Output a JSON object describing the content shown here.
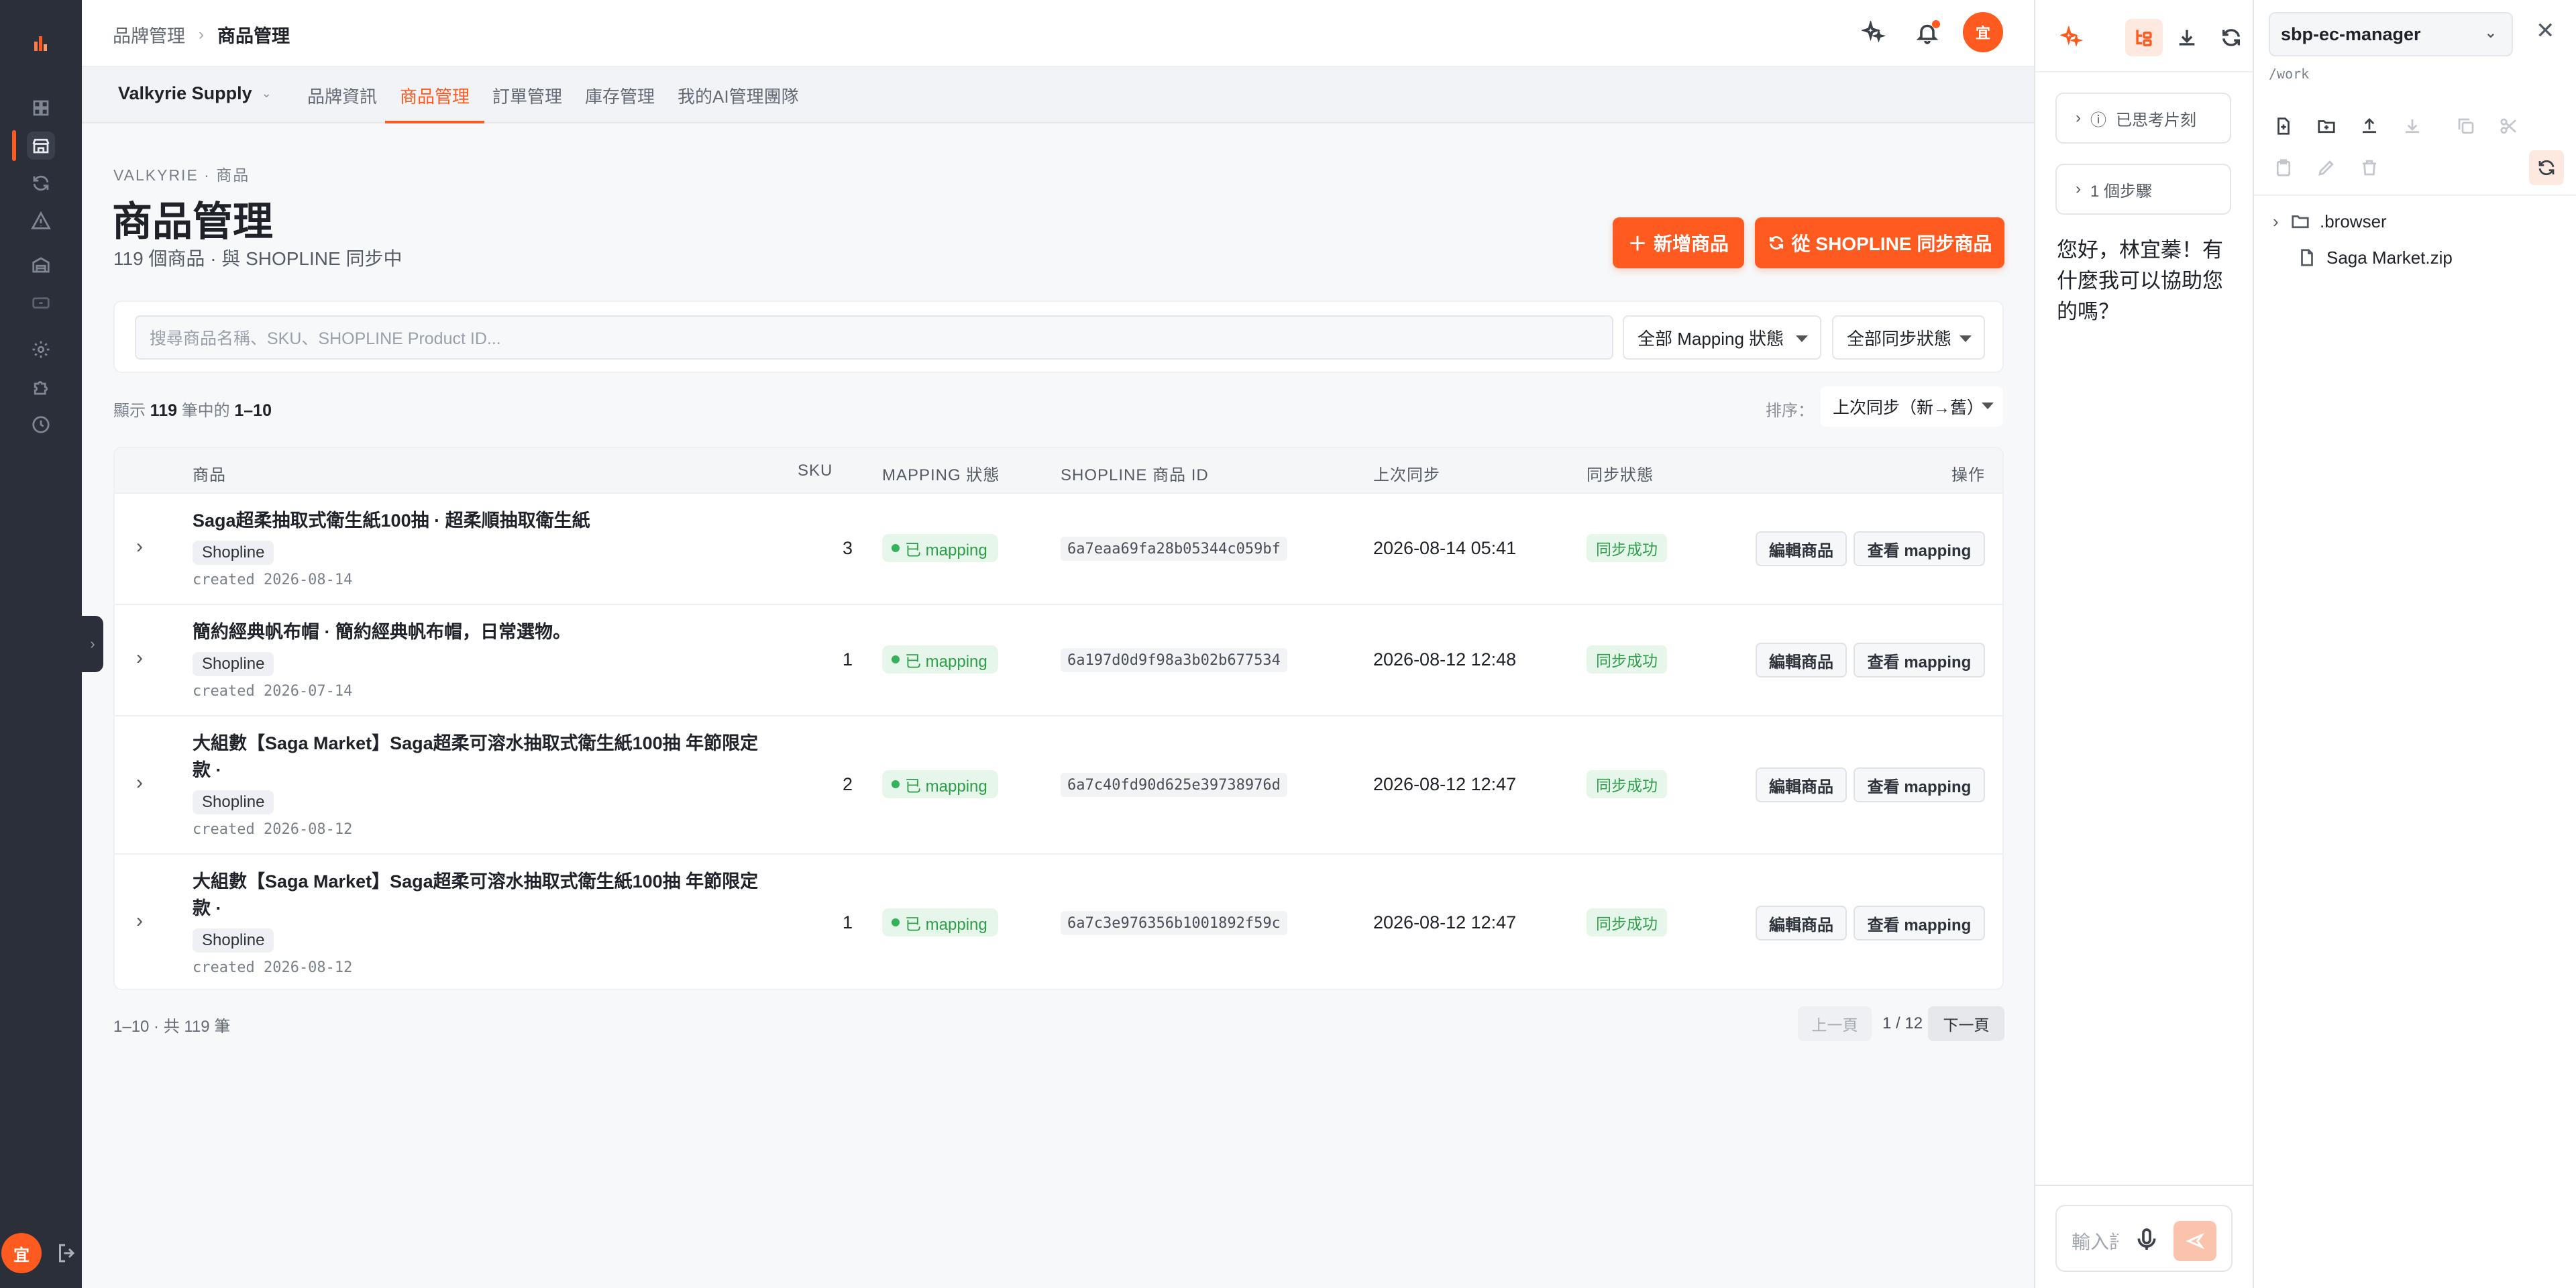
{
  "sidebar": {
    "items": [
      {
        "icon": "dashboard-icon"
      },
      {
        "icon": "store-icon",
        "active": true
      },
      {
        "icon": "sync-icon"
      },
      {
        "icon": "alert-icon"
      },
      {
        "icon": "warehouse-icon"
      },
      {
        "icon": "card-icon"
      },
      {
        "icon": "settings-icon"
      },
      {
        "icon": "puzzle-icon"
      },
      {
        "icon": "history-icon"
      }
    ],
    "avatar_text": "宜",
    "collapse_icon": "›"
  },
  "header": {
    "breadcrumb_parent": "品牌管理",
    "breadcrumb_sep": "›",
    "breadcrumb_current": "商品管理",
    "avatar_text": "宜"
  },
  "subnav": {
    "brand": "Valkyrie Supply",
    "tabs": [
      {
        "label": "品牌資訊"
      },
      {
        "label": "商品管理",
        "active": true
      },
      {
        "label": "訂單管理"
      },
      {
        "label": "庫存管理"
      },
      {
        "label": "我的AI管理團隊"
      }
    ]
  },
  "page": {
    "eyebrow": "VALKYRIE · 商品",
    "title": "商品管理",
    "subtitle": "119 個商品 · 與 SHOPLINE 同步中",
    "btn_add": "新增商品",
    "btn_sync": "從 SHOPLINE 同步商品"
  },
  "filters": {
    "search_placeholder": "搜尋商品名稱、SKU、SHOPLINE Product ID...",
    "mapping_status": "全部 Mapping 狀態",
    "sync_status": "全部同步狀態"
  },
  "results": {
    "prefix": "顯示",
    "total": "119",
    "middle": "筆中的",
    "range": "1–10",
    "sort_label": "排序：",
    "sort_value": "上次同步（新→舊）"
  },
  "table": {
    "headers": {
      "product": "商品",
      "sku": "SKU",
      "mapping": "MAPPING 狀態",
      "shopline_id": "SHOPLINE 商品 ID",
      "last_sync": "上次同步",
      "sync_status": "同步狀態",
      "actions": "操作"
    },
    "rows": [
      {
        "name": "Saga超柔抽取式衛生紙100抽 · 超柔順抽取衛生紙",
        "tag": "Shopline",
        "created": "created 2026-08-14",
        "sku": "3",
        "mapping": "已 mapping",
        "shopline_id": "6a7eaa69fa28b05344c059bf",
        "last_sync": "2026-08-14 05:41",
        "sync_status": "同步成功",
        "edit": "編輯商品",
        "view": "查看 mapping"
      },
      {
        "name": "簡約經典帆布帽 · 簡約經典帆布帽，日常選物。",
        "tag": "Shopline",
        "created": "created 2026-07-14",
        "sku": "1",
        "mapping": "已 mapping",
        "shopline_id": "6a197d0d9f98a3b02b677534",
        "last_sync": "2026-08-12 12:48",
        "sync_status": "同步成功",
        "edit": "編輯商品",
        "view": "查看 mapping"
      },
      {
        "name": "大組數【Saga Market】Saga超柔可溶水抽取式衛生紙100抽 年節限定款 ·",
        "tag": "Shopline",
        "created": "created 2026-08-12",
        "sku": "2",
        "mapping": "已 mapping",
        "shopline_id": "6a7c40fd90d625e39738976d",
        "last_sync": "2026-08-12 12:47",
        "sync_status": "同步成功",
        "edit": "編輯商品",
        "view": "查看 mapping"
      },
      {
        "name": "大組數【Saga Market】Saga超柔可溶水抽取式衛生紙100抽 年節限定款 ·",
        "tag": "Shopline",
        "created": "created 2026-08-12",
        "sku": "1",
        "mapping": "已 mapping",
        "shopline_id": "6a7c3e976356b1001892f59c",
        "last_sync": "2026-08-12 12:47",
        "sync_status": "同步成功",
        "edit": "編輯商品",
        "view": "查看 mapping"
      }
    ]
  },
  "pagination": {
    "range_text": "1–10 · 共 119 筆",
    "prev": "上一頁",
    "page": "1 / 12",
    "next": "下一頁"
  },
  "chat": {
    "thinking": "已思考片刻",
    "steps": "1 個步驟",
    "message": "您好，林宜蓁！有什麼我可以協助您的嗎？",
    "input_placeholder": "輸入訊息"
  },
  "files": {
    "project": "sbp-ec-manager",
    "path": "/work",
    "tree": [
      {
        "name": ".browser",
        "type": "folder"
      },
      {
        "name": "Saga Market.zip",
        "type": "file"
      }
    ]
  },
  "colors": {
    "accent": "#ff5a1f",
    "sidebar_bg": "#2b2f3a",
    "success": "#2f9e4a"
  }
}
